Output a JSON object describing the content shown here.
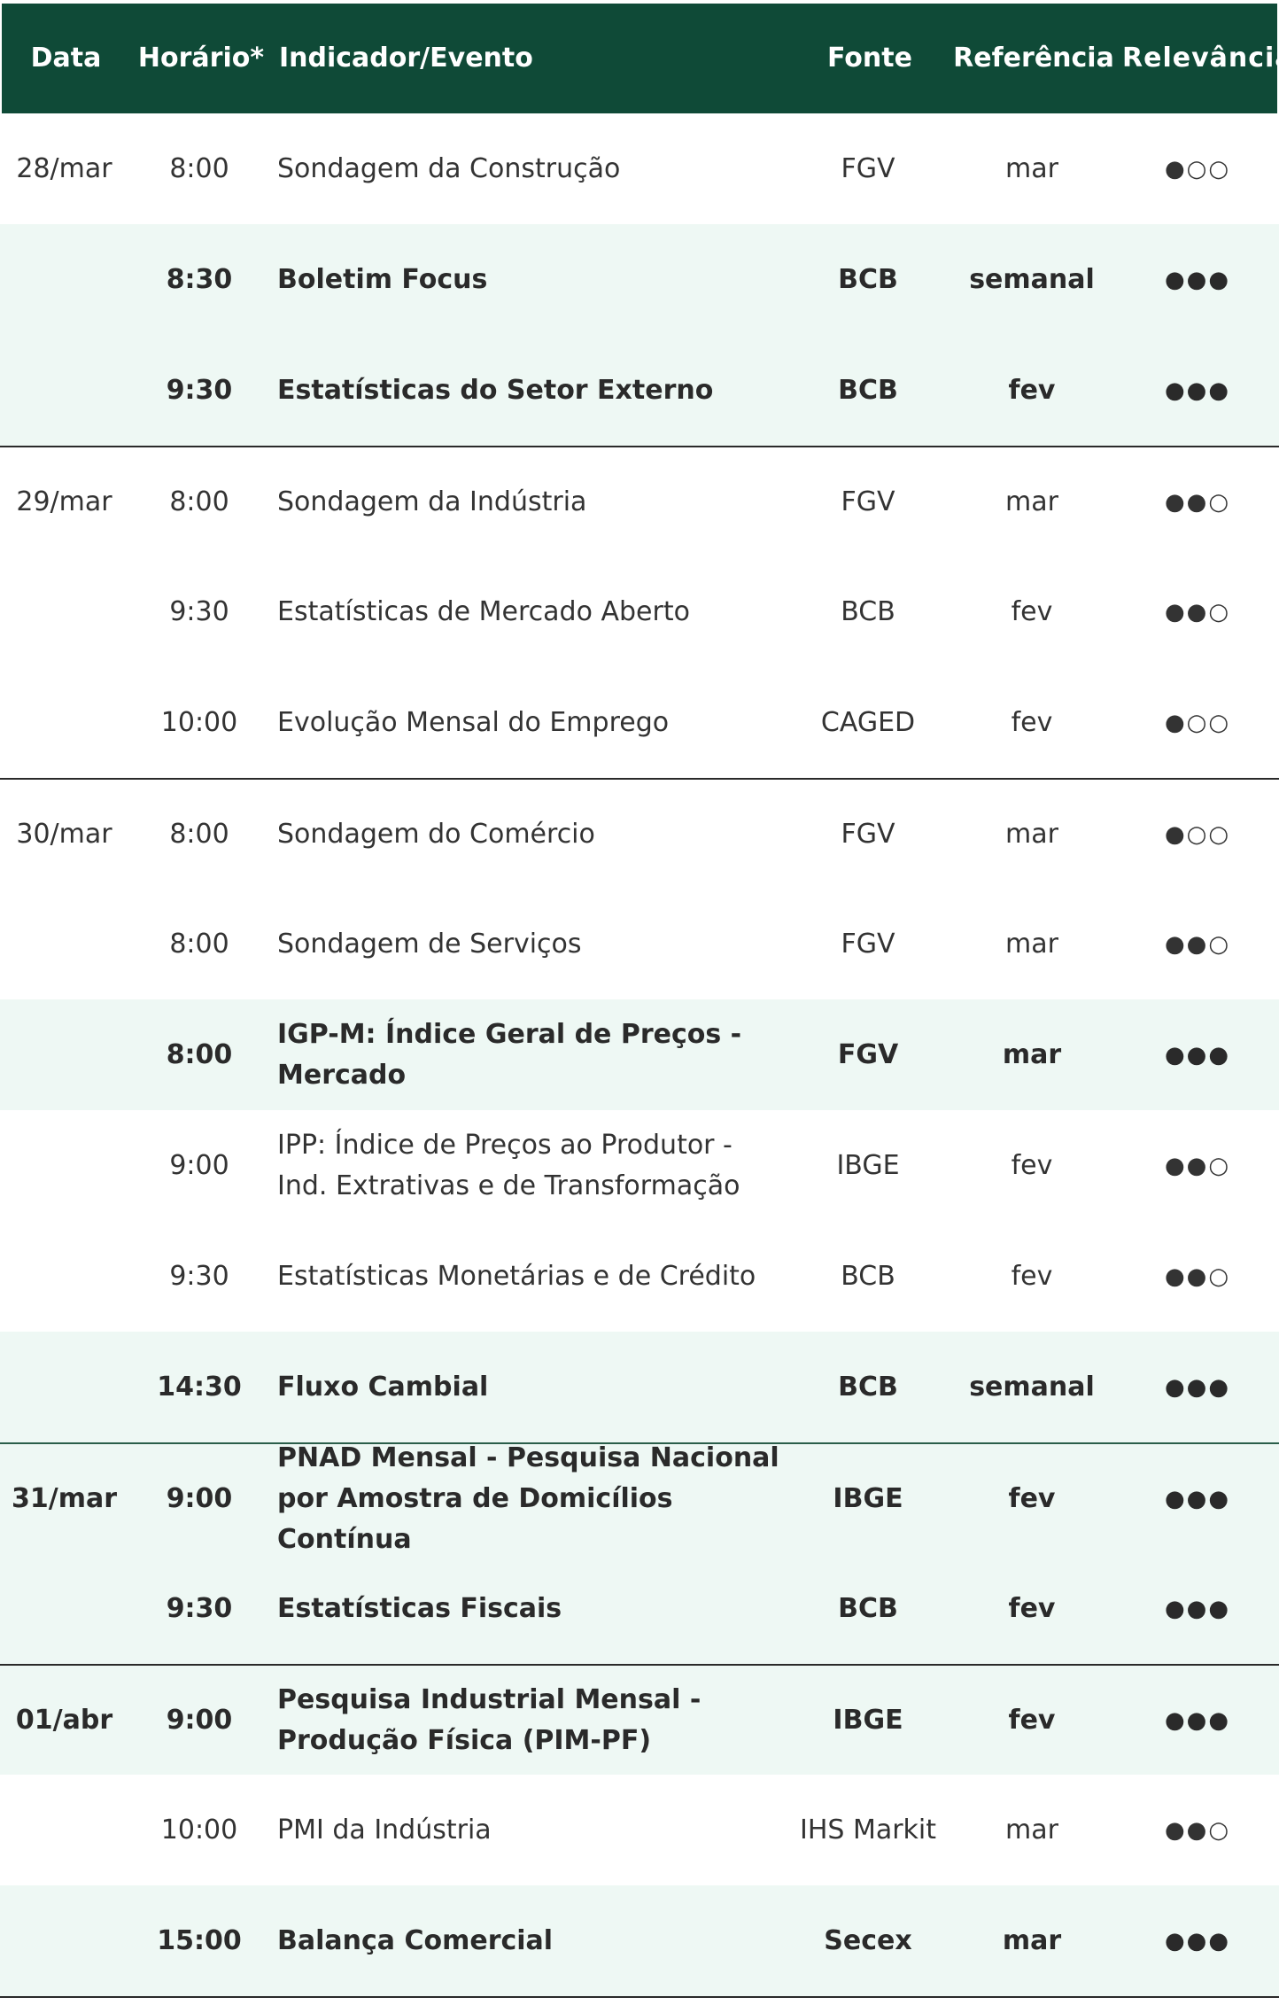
{
  "header": {
    "date": "Data",
    "time": "Horário*",
    "indicator": "Indicador/Evento",
    "source": "Fonte",
    "reference": "Referência",
    "relevance": "Relevância"
  },
  "colors": {
    "header_bg": "#0f4a37",
    "highlight_row": "#eef8f4"
  },
  "rows": [
    {
      "date": "28/mar",
      "time": "8:00",
      "indicator": "Sondagem da Construção",
      "source": "FGV",
      "reference": "mar",
      "relevance": "●○○",
      "highlight": false,
      "bold": false
    },
    {
      "date": "",
      "time": "8:30",
      "indicator": "Boletim Focus",
      "source": "BCB",
      "reference": "semanal",
      "relevance": "●●●",
      "highlight": true,
      "bold": true
    },
    {
      "date": "",
      "time": "9:30",
      "indicator": "Estatísticas do Setor Externo",
      "source": "BCB",
      "reference": "fev",
      "relevance": "●●●",
      "highlight": true,
      "bold": true
    },
    {
      "date": "29/mar",
      "time": "8:00",
      "indicator": "Sondagem da Indústria",
      "source": "FGV",
      "reference": "mar",
      "relevance": "●●○",
      "highlight": false,
      "bold": false
    },
    {
      "date": "",
      "time": "9:30",
      "indicator": "Estatísticas de Mercado Aberto",
      "source": "BCB",
      "reference": "fev",
      "relevance": "●●○",
      "highlight": false,
      "bold": false
    },
    {
      "date": "",
      "time": "10:00",
      "indicator": "Evolução Mensal do Emprego",
      "source": "CAGED",
      "reference": "fev",
      "relevance": "●○○",
      "highlight": false,
      "bold": false
    },
    {
      "date": "30/mar",
      "time": "8:00",
      "indicator": "Sondagem do Comércio",
      "source": "FGV",
      "reference": "mar",
      "relevance": "●○○",
      "highlight": false,
      "bold": false
    },
    {
      "date": "",
      "time": "8:00",
      "indicator": "Sondagem de Serviços",
      "source": "FGV",
      "reference": "mar",
      "relevance": "●●○",
      "highlight": false,
      "bold": false
    },
    {
      "date": "",
      "time": "8:00",
      "indicator": "IGP-M: Índice Geral de Preços - Mercado",
      "source": "FGV",
      "reference": "mar",
      "relevance": "●●●",
      "highlight": true,
      "bold": true
    },
    {
      "date": "",
      "time": "9:00",
      "indicator": "IPP: Índice de Preços ao Produtor - Ind. Extrativas e de Transformação",
      "source": "IBGE",
      "reference": "fev",
      "relevance": "●●○",
      "highlight": false,
      "bold": false
    },
    {
      "date": "",
      "time": "9:30",
      "indicator": "Estatísticas Monetárias e de Crédito",
      "source": "BCB",
      "reference": "fev",
      "relevance": "●●○",
      "highlight": false,
      "bold": false
    },
    {
      "date": "",
      "time": "14:30",
      "indicator": "Fluxo Cambial",
      "source": "BCB",
      "reference": "semanal",
      "relevance": "●●●",
      "highlight": true,
      "bold": true
    },
    {
      "date": "31/mar",
      "time": "9:00",
      "indicator": "PNAD Mensal - Pesquisa Nacional por Amostra de Domicílios Contínua",
      "source": "IBGE",
      "reference": "fev",
      "relevance": "●●●",
      "highlight": true,
      "bold": true
    },
    {
      "date": "",
      "time": "9:30",
      "indicator": "Estatísticas Fiscais",
      "source": "BCB",
      "reference": "fev",
      "relevance": "●●●",
      "highlight": true,
      "bold": true
    },
    {
      "date": "01/abr",
      "time": "9:00",
      "indicator": "Pesquisa Industrial Mensal - Produção Física (PIM-PF)",
      "source": "IBGE",
      "reference": "fev",
      "relevance": "●●●",
      "highlight": true,
      "bold": true
    },
    {
      "date": "",
      "time": "10:00",
      "indicator": "PMI da Indústria",
      "source": "IHS Markit",
      "reference": "mar",
      "relevance": "●●○",
      "highlight": false,
      "bold": false
    },
    {
      "date": "",
      "time": "15:00",
      "indicator": "Balança Comercial",
      "source": "Secex",
      "reference": "mar",
      "relevance": "●●●",
      "highlight": true,
      "bold": true
    }
  ]
}
